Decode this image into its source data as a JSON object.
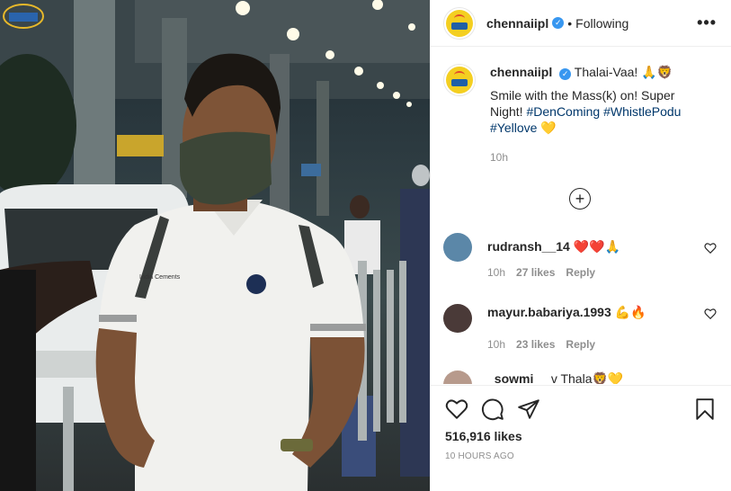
{
  "post": {
    "username": "chennaiipl",
    "follow_state": "Following",
    "separator": "•",
    "more": "•••"
  },
  "caption": {
    "username": "chennaiipl",
    "first_line": "Thalai-Vaa! 🙏🦁",
    "body": "Smile with the Mass(k) on! Super Night! ",
    "hashtags": [
      "#DenComing",
      "#WhistlePodu",
      "#Yellove"
    ],
    "emoji_end": "💛",
    "time": "10h"
  },
  "load_more_icon": "plus-circle-icon",
  "comments": [
    {
      "username": "rudransh__14",
      "text": "❤️❤️🙏",
      "time": "10h",
      "likes": "27 likes",
      "reply": "Reply"
    },
    {
      "username": "mayur.babariya.1993",
      "text": "💪🔥",
      "time": "10h",
      "likes": "23 likes",
      "reply": "Reply"
    },
    {
      "username": "_sowmi__",
      "text": "v Thala🦁💛",
      "time": "",
      "likes": "",
      "reply": ""
    }
  ],
  "actions": {
    "like_icon": "heart-icon",
    "comment_icon": "comment-icon",
    "share_icon": "paper-plane-icon",
    "save_icon": "bookmark-icon",
    "likes": "516,916 likes",
    "posted": "10 HOURS AGO"
  },
  "colors": {
    "verified": "#3897f0",
    "link": "#00376b",
    "muted": "#8e8e8e",
    "heart": "#ed4956",
    "brand_yellow": "#f4cf21"
  }
}
